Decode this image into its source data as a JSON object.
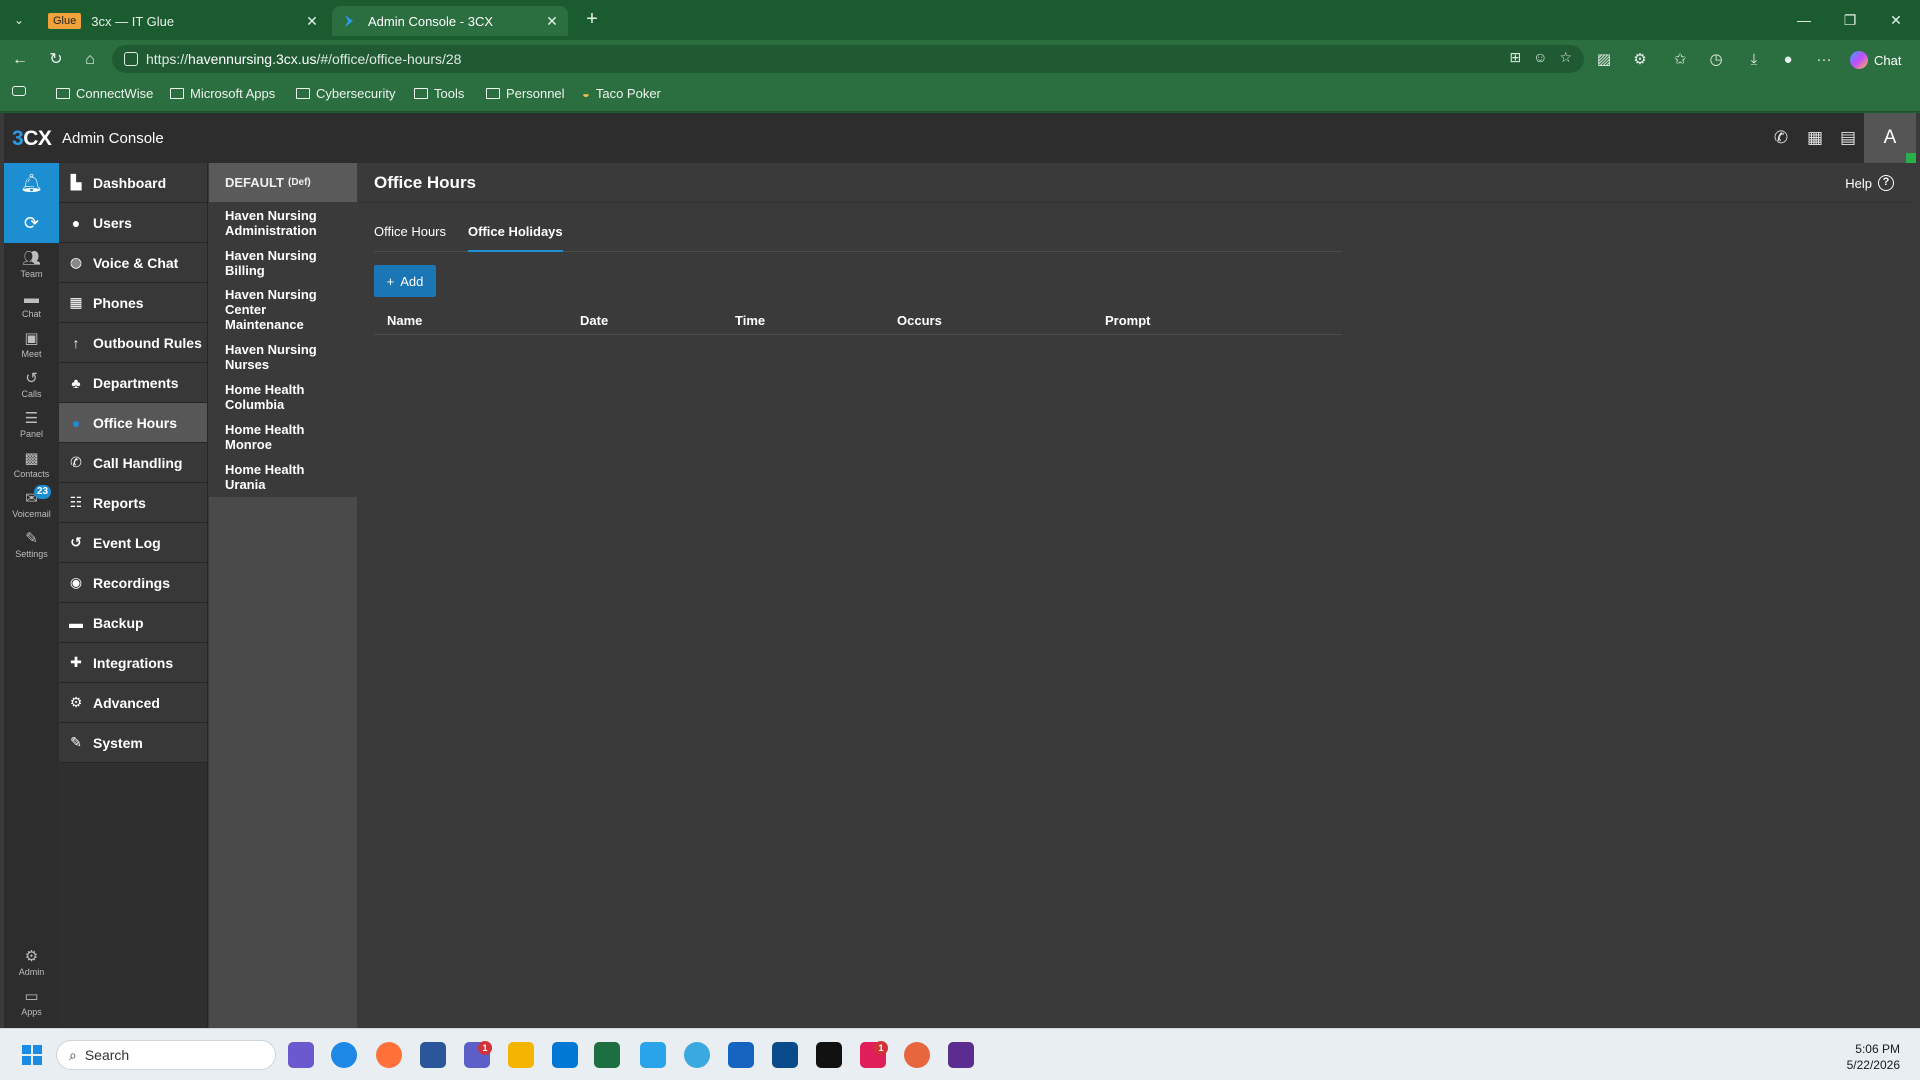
{
  "browser": {
    "tabs": [
      {
        "badge": "Glue",
        "title": "3cx — IT Glue"
      },
      {
        "title": "Admin Console - 3CX"
      }
    ],
    "url_prefix": "https://",
    "url_host": "havennursing.3cx.us",
    "url_path": "/#/office/office-hours/28",
    "chat_label": "Chat",
    "bookmarks": [
      "ConnectWise",
      "Microsoft Apps",
      "Cybersecurity",
      "Tools",
      "Personnel",
      "Taco Poker"
    ]
  },
  "app": {
    "logo": "3CX",
    "title": "Admin Console",
    "avatar_letter": "A",
    "accent": "#1c8ed1"
  },
  "rail": {
    "items": [
      {
        "label": "Team",
        "icon": "team-icon"
      },
      {
        "label": "Chat",
        "icon": "chat-icon"
      },
      {
        "label": "Meet",
        "icon": "meet-icon"
      },
      {
        "label": "Calls",
        "icon": "calls-icon"
      },
      {
        "label": "Panel",
        "icon": "panel-icon"
      },
      {
        "label": "Contacts",
        "icon": "contacts-icon"
      },
      {
        "label": "Voicemail",
        "icon": "voicemail-icon",
        "badge": "23"
      },
      {
        "label": "Settings",
        "icon": "settings-icon"
      }
    ],
    "bottom": [
      {
        "label": "Admin",
        "icon": "admin-icon"
      },
      {
        "label": "Apps",
        "icon": "apps-icon"
      }
    ]
  },
  "nav": {
    "items": [
      "Dashboard",
      "Users",
      "Voice & Chat",
      "Phones",
      "Outbound Rules",
      "Departments",
      "Office Hours",
      "Call Handling",
      "Reports",
      "Event Log",
      "Recordings",
      "Backup",
      "Integrations",
      "Advanced",
      "System"
    ],
    "active": "Office Hours"
  },
  "departments": {
    "default_name": "DEFAULT",
    "default_tag": "(Def)",
    "items": [
      "Haven Nursing Administration",
      "Haven Nursing Billing",
      "Haven Nursing Center Maintenance",
      "Haven Nursing Nurses",
      "Home Health Columbia",
      "Home Health Monroe",
      "Home Health Urania"
    ]
  },
  "content": {
    "title": "Office Hours",
    "help_label": "Help",
    "tabs": [
      "Office Hours",
      "Office Holidays"
    ],
    "active_tab": "Office Holidays",
    "add_label": "Add",
    "columns": [
      "Name",
      "Date",
      "Time",
      "Occurs",
      "Prompt"
    ]
  },
  "taskbar": {
    "search_placeholder": "Search",
    "time": "5:06 PM",
    "date": "5/22/2026",
    "badges": {
      "teams": "1",
      "slack": "1"
    }
  }
}
